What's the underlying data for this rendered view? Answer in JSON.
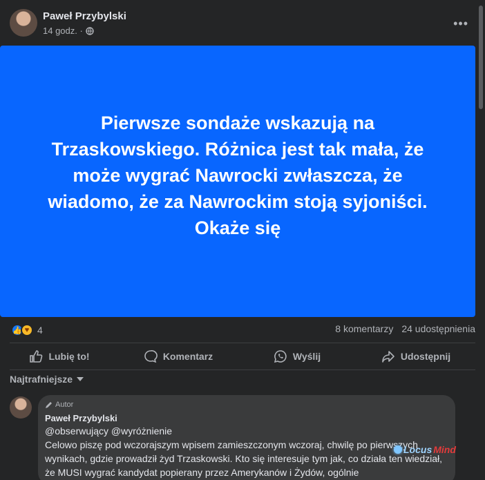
{
  "post": {
    "author": "Paweł Przybylski",
    "time": "14 godz. ·",
    "more_icon": "more-horizontal-icon",
    "background_color": "#0866ff",
    "text": "Pierwsze sondaże wskazują na Trzaskowskiego. Różnica jest tak mała, że może wygrać Nawrocki zwłaszcza, że wiadomo, że za Nawrockim stoją syjoniści. Okaże się",
    "reaction_count": "4",
    "comments_count": "8 komentarzy",
    "shares_count": "24 udostępnienia"
  },
  "actions": {
    "like": "Lubię to!",
    "comment": "Komentarz",
    "send": "Wyślij",
    "share": "Udostępnij"
  },
  "sort_label": "Najtrafniejsze",
  "comment": {
    "badge": "Autor",
    "author": "Paweł Przybylski",
    "text": "@obserwujący @wyróżnienie\nCelowo piszę pod wczorajszym wpisem zamieszczonym wczoraj, chwilę po pierwszych wynikach, gdzie prowadził żyd Trzaskowski. Kto się interesuje tym jak, co działa ten wiedział, że MUSI wygrać kandydat popierany przez Amerykanów i Żydów, ogólnie"
  },
  "watermark": {
    "part1": "Locus",
    "part2": "Mind"
  }
}
